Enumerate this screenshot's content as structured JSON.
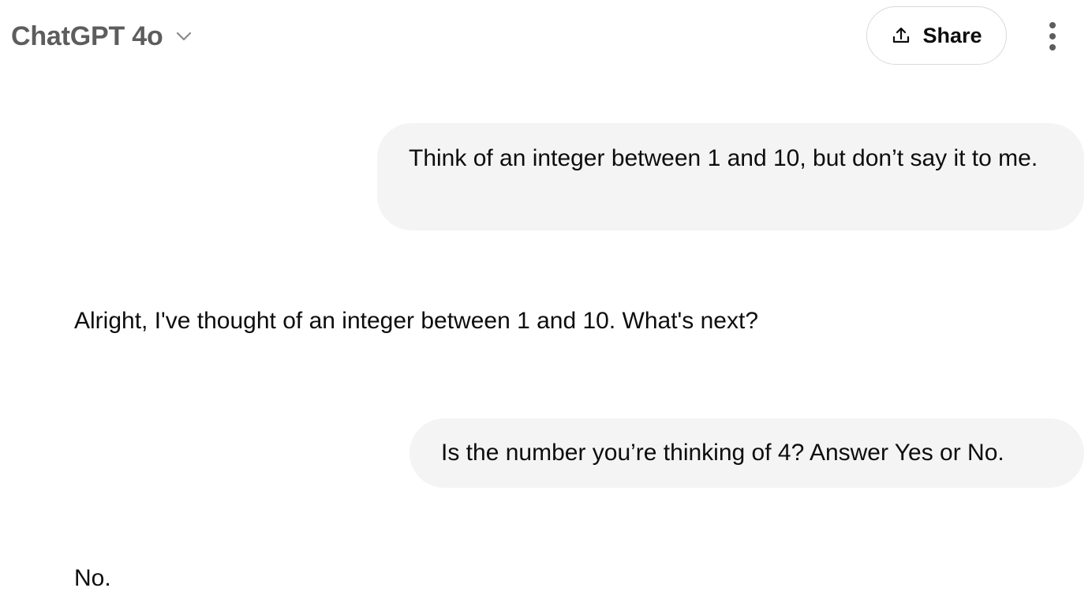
{
  "header": {
    "model_name": "ChatGPT 4o",
    "chevron_icon": "chevron-down-icon",
    "share_label": "Share",
    "share_icon": "share-upload-icon",
    "more_icon": "more-vertical-icon"
  },
  "messages": [
    {
      "role": "user",
      "text": "Think of an integer between 1 and 10, but don’t say it to me."
    },
    {
      "role": "assistant",
      "text": "Alright, I've thought of an integer between 1 and 10. What's next?"
    },
    {
      "role": "user",
      "text": "Is the number you’re thinking of 4? Answer Yes or No."
    },
    {
      "role": "assistant",
      "text": "No."
    }
  ],
  "colors": {
    "user_bubble_bg": "#f4f4f4",
    "text": "#0d0d0d",
    "model_name": "#5d5d5d",
    "border": "#d9d9d9"
  }
}
